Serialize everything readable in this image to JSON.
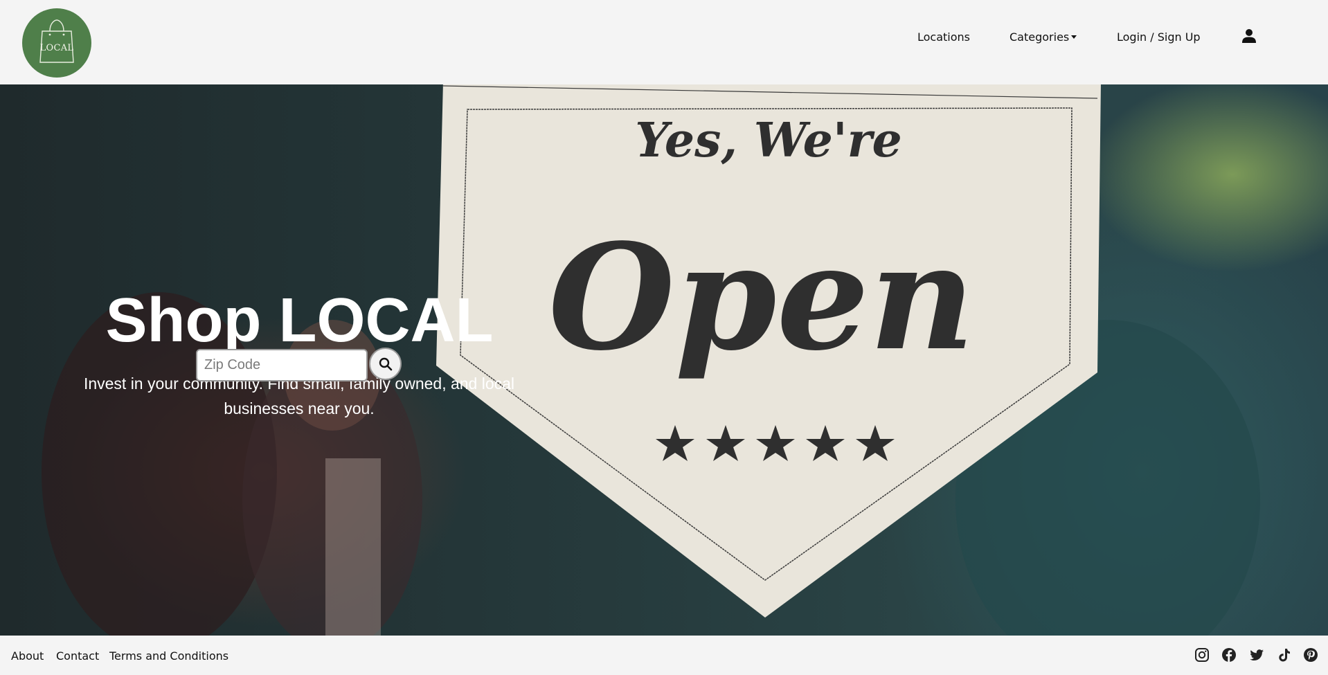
{
  "header": {
    "logo_text": "LOCAL",
    "nav": {
      "locations": "Locations",
      "categories": "Categories",
      "login": "Login / Sign Up"
    },
    "user_icon": "user-icon"
  },
  "hero": {
    "title": "Shop LOCAL",
    "subtitle": "Invest in your community. Find small, family owned, and local businesses near you.",
    "search": {
      "placeholder": "Zip Code",
      "value": "",
      "button_icon": "search-icon"
    },
    "image_text": {
      "line1": "Yes, We're",
      "line2": "Open"
    }
  },
  "footer": {
    "links": {
      "about": "About",
      "contact": "Contact",
      "terms": "Terms and Conditions"
    },
    "social_icons": [
      "instagram-icon",
      "facebook-icon",
      "twitter-icon",
      "tiktok-icon",
      "pinterest-icon"
    ]
  },
  "colors": {
    "logo_green": "#4f7f4a",
    "header_bg": "#f4f4f4",
    "hero_text": "#ffffff"
  }
}
